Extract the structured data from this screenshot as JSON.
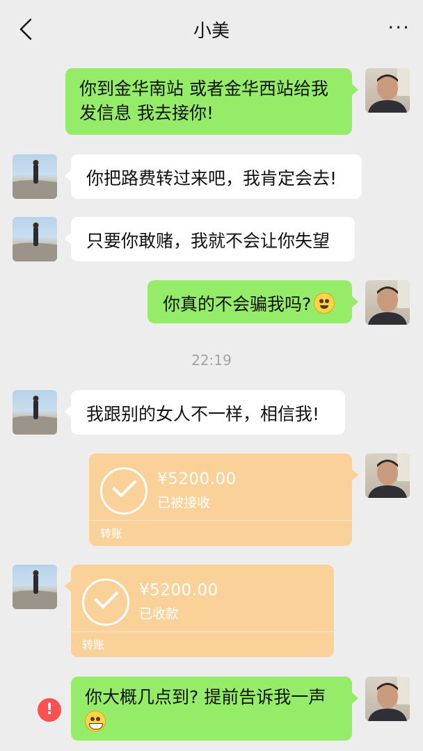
{
  "header": {
    "title": "小美",
    "back_icon": "chevron-left-icon",
    "more_icon": "more-dots-icon",
    "more_label": "···"
  },
  "messages": [
    {
      "side": "right",
      "text": "你到金华南站 或者金华西站给我发信息 我去接你!"
    },
    {
      "side": "left",
      "text": "你把路费转过来吧，我肯定会去!"
    },
    {
      "side": "left",
      "text": "只要你敢赌，我就不会让你失望"
    },
    {
      "side": "right",
      "text": "你真的不会骗我吗?",
      "emoji": "flushed-face-icon"
    },
    {
      "side": "left",
      "text": "我跟别的女人不一样，相信我!"
    },
    {
      "side": "right",
      "text": "你大概几点到? 提前告诉我一声",
      "emoji": "grinning-face-icon"
    }
  ],
  "timestamp": "22:19",
  "transfers": [
    {
      "side": "right",
      "amount": "¥5200.00",
      "status": "已被接收",
      "kind": "转账"
    },
    {
      "side": "left",
      "amount": "¥5200.00",
      "status": "已收款",
      "kind": "转账"
    }
  ],
  "error_badge": "!",
  "colors": {
    "background": "#ededed",
    "sent_bubble": "#95ec69",
    "received_bubble": "#ffffff",
    "transfer_card": "#fad199",
    "error": "#fa5151"
  }
}
